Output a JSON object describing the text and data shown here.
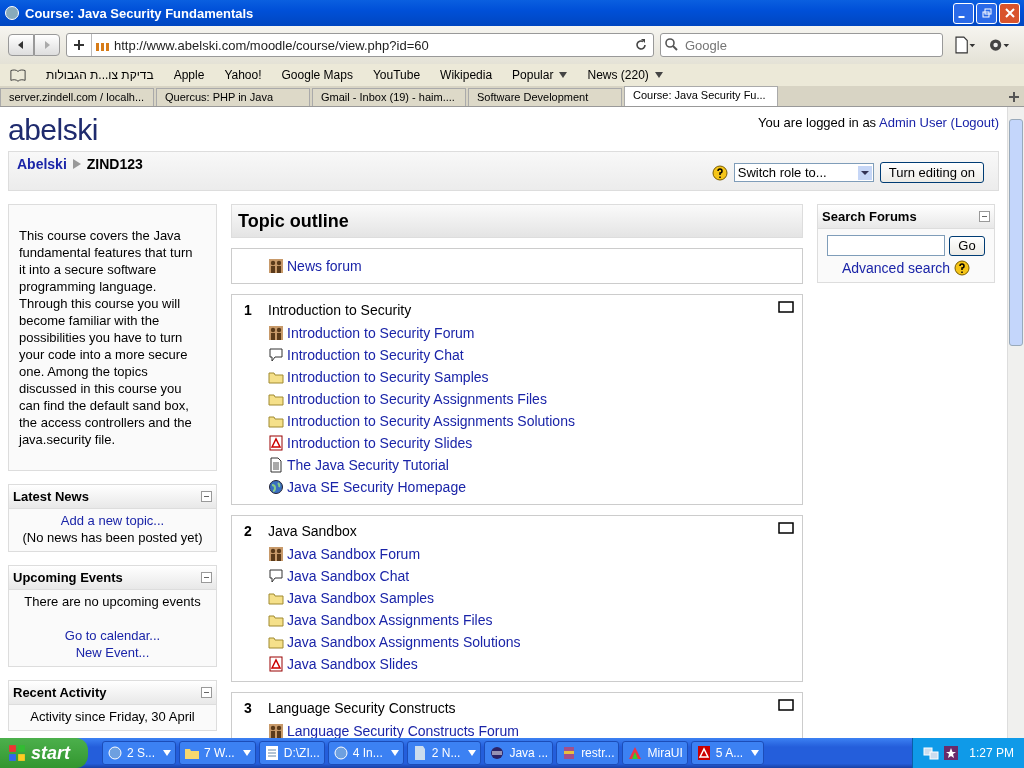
{
  "window": {
    "title": "Course: Java Security Fundamentals"
  },
  "browser": {
    "url": "http://www.abelski.com/moodle/course/view.php?id=60",
    "search_placeholder": "Google",
    "bookmarks": [
      {
        "label": "בדיקת צו...ת הגבולות",
        "menu": false
      },
      {
        "label": "Apple",
        "menu": false
      },
      {
        "label": "Yahoo!",
        "menu": false
      },
      {
        "label": "Google Maps",
        "menu": false
      },
      {
        "label": "YouTube",
        "menu": false
      },
      {
        "label": "Wikipedia",
        "menu": false
      },
      {
        "label": "Popular",
        "menu": true
      },
      {
        "label": "News (220)",
        "menu": true
      }
    ],
    "tabs": [
      {
        "label": "server.zindell.com / localh...",
        "selected": false
      },
      {
        "label": "Quercus: PHP in Java",
        "selected": false
      },
      {
        "label": "Gmail - Inbox (19) - haim....",
        "selected": false
      },
      {
        "label": "Software Development",
        "selected": false
      },
      {
        "label": "Course: Java Security Fu...",
        "selected": true
      }
    ]
  },
  "site": {
    "logo": "abelski",
    "login_text": "You are logged in as",
    "login_user": "Admin User",
    "logout": "(Logout)",
    "breadcrumb": [
      "Abelski",
      "ZIND123"
    ],
    "role_select": "Switch role to...",
    "editing_button": "Turn editing on"
  },
  "summary": "This course covers the Java fundamental features that turn it into a secure software programming language. Through this course you will become familiar with the possibilities you have to turn your code into a more secure one. Among the topics discussed in this course you can find the default sand box, the access controllers and the java.security file.",
  "blocks": [
    {
      "title": "Latest News",
      "lines": [
        {
          "text": "Add a new topic...",
          "link": true
        },
        {
          "text": "(No news has been posted yet)",
          "link": false
        }
      ]
    },
    {
      "title": "Upcoming Events",
      "lines": [
        {
          "text": "There are no upcoming events",
          "link": false
        },
        {
          "text": "Go to calendar...",
          "link": true
        },
        {
          "text": "New Event...",
          "link": true
        }
      ]
    },
    {
      "title": "Recent Activity",
      "lines": [
        {
          "text": "Activity since Friday, 30 April",
          "link": false
        }
      ]
    }
  ],
  "topic_outline": {
    "title": "Topic outline",
    "intro": [
      {
        "kind": "forum",
        "label": "News forum"
      }
    ],
    "sections": [
      {
        "number": "1",
        "title": "Introduction to Security",
        "items": [
          {
            "kind": "forum",
            "label": "Introduction to Security Forum"
          },
          {
            "kind": "chat",
            "label": "Introduction to Security Chat"
          },
          {
            "kind": "folder",
            "label": "Introduction to Security Samples"
          },
          {
            "kind": "folder",
            "label": "Introduction to Security Assignments Files"
          },
          {
            "kind": "folder",
            "label": "Introduction to Security Assignments Solutions"
          },
          {
            "kind": "pdf",
            "label": "Introduction to Security Slides"
          },
          {
            "kind": "page",
            "label": "The Java Security Tutorial"
          },
          {
            "kind": "web",
            "label": "Java SE Security Homepage"
          }
        ]
      },
      {
        "number": "2",
        "title": "Java Sandbox",
        "items": [
          {
            "kind": "forum",
            "label": "Java Sandbox Forum"
          },
          {
            "kind": "chat",
            "label": "Java Sandbox Chat"
          },
          {
            "kind": "folder",
            "label": "Java Sandbox Samples"
          },
          {
            "kind": "folder",
            "label": "Java Sandbox Assignments Files"
          },
          {
            "kind": "folder",
            "label": "Java Sandbox Assignments Solutions"
          },
          {
            "kind": "pdf",
            "label": "Java Sandbox Slides"
          }
        ]
      },
      {
        "number": "3",
        "title": "Language Security Constructs",
        "items": [
          {
            "kind": "forum",
            "label": "Language Security Constructs Forum"
          }
        ]
      }
    ]
  },
  "search_forums": {
    "title": "Search Forums",
    "button": "Go",
    "advanced": "Advanced search"
  },
  "taskbar": {
    "start": "start",
    "items": [
      {
        "kind": "ie",
        "label": "2 S...",
        "group": true
      },
      {
        "kind": "folder",
        "label": "7 W...",
        "group": true
      },
      {
        "kind": "note",
        "label": "D:\\ZI...",
        "group": false
      },
      {
        "kind": "ie",
        "label": "4 In...",
        "group": true
      },
      {
        "kind": "doc",
        "label": "2 N...",
        "group": true
      },
      {
        "kind": "eclipse",
        "label": "Java ...",
        "group": false
      },
      {
        "kind": "rar",
        "label": "restr...",
        "group": false
      },
      {
        "kind": "app",
        "label": "MiraUI",
        "group": false
      },
      {
        "kind": "pdf",
        "label": "5 A...",
        "group": true
      }
    ],
    "clock": "1:27 PM"
  }
}
